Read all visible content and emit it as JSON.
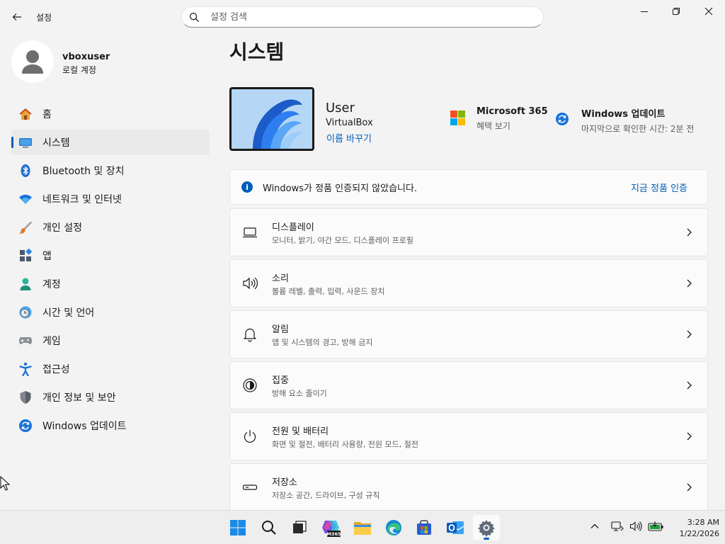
{
  "window": {
    "title": "설정",
    "search_placeholder": "설정 검색"
  },
  "profile": {
    "name": "vboxuser",
    "account_type": "로컬 계정"
  },
  "sidebar": {
    "items": [
      {
        "label": "홈",
        "icon": "home-icon"
      },
      {
        "label": "시스템",
        "icon": "system-icon",
        "selected": true
      },
      {
        "label": "Bluetooth 및 장치",
        "icon": "bluetooth-icon"
      },
      {
        "label": "네트워크 및 인터넷",
        "icon": "wifi-icon"
      },
      {
        "label": "개인 설정",
        "icon": "brush-icon"
      },
      {
        "label": "앱",
        "icon": "apps-icon"
      },
      {
        "label": "계정",
        "icon": "account-icon"
      },
      {
        "label": "시간 및 언어",
        "icon": "time-language-icon"
      },
      {
        "label": "게임",
        "icon": "gaming-icon"
      },
      {
        "label": "접근성",
        "icon": "accessibility-icon"
      },
      {
        "label": "개인 정보 및 보안",
        "icon": "shield-icon"
      },
      {
        "label": "Windows 업데이트",
        "icon": "update-icon"
      }
    ]
  },
  "main": {
    "title": "시스템",
    "device": {
      "name": "User",
      "model": "VirtualBox",
      "rename_link": "이름 바꾸기"
    },
    "promos": [
      {
        "title": "Microsoft 365",
        "subtitle": "혜택 보기",
        "icon": "microsoft-logo-icon"
      },
      {
        "title": "Windows 업데이트",
        "subtitle": "마지막으로 확인한 시간: 2분 전",
        "icon": "update-icon"
      }
    ],
    "activation": {
      "message": "Windows가 정품 인증되지 않았습니다.",
      "action": "지금 정품 인증"
    },
    "cards": [
      {
        "title": "디스플레이",
        "subtitle": "모니터, 밝기, 야간 모드, 디스플레이 프로필",
        "icon": "display-icon"
      },
      {
        "title": "소리",
        "subtitle": "볼륨 레벨, 출력, 입력, 사운드 장치",
        "icon": "speaker-icon"
      },
      {
        "title": "알림",
        "subtitle": "앱 및 시스템의 경고, 방해 금지",
        "icon": "bell-icon"
      },
      {
        "title": "집중",
        "subtitle": "방해 요소 줄이기",
        "icon": "focus-icon"
      },
      {
        "title": "전원 및 배터리",
        "subtitle": "화면 및 절전, 배터리 사용량, 전원 모드, 절전",
        "icon": "power-icon"
      },
      {
        "title": "저장소",
        "subtitle": "저장소 공간, 드라이브, 구성 규칙",
        "icon": "storage-icon"
      }
    ]
  },
  "taskbar": {
    "apps": [
      "start-icon",
      "search-icon",
      "task-view-icon",
      "copilot-m365-icon",
      "file-explorer-icon",
      "edge-icon",
      "store-icon",
      "outlook-icon",
      "settings-icon"
    ],
    "m365_badge": "M365",
    "time": "3:28 AM",
    "date": "1/22/2026"
  },
  "colors": {
    "accent": "#005fb8",
    "background": "#f3f3f3",
    "card": "#fbfbfb"
  }
}
